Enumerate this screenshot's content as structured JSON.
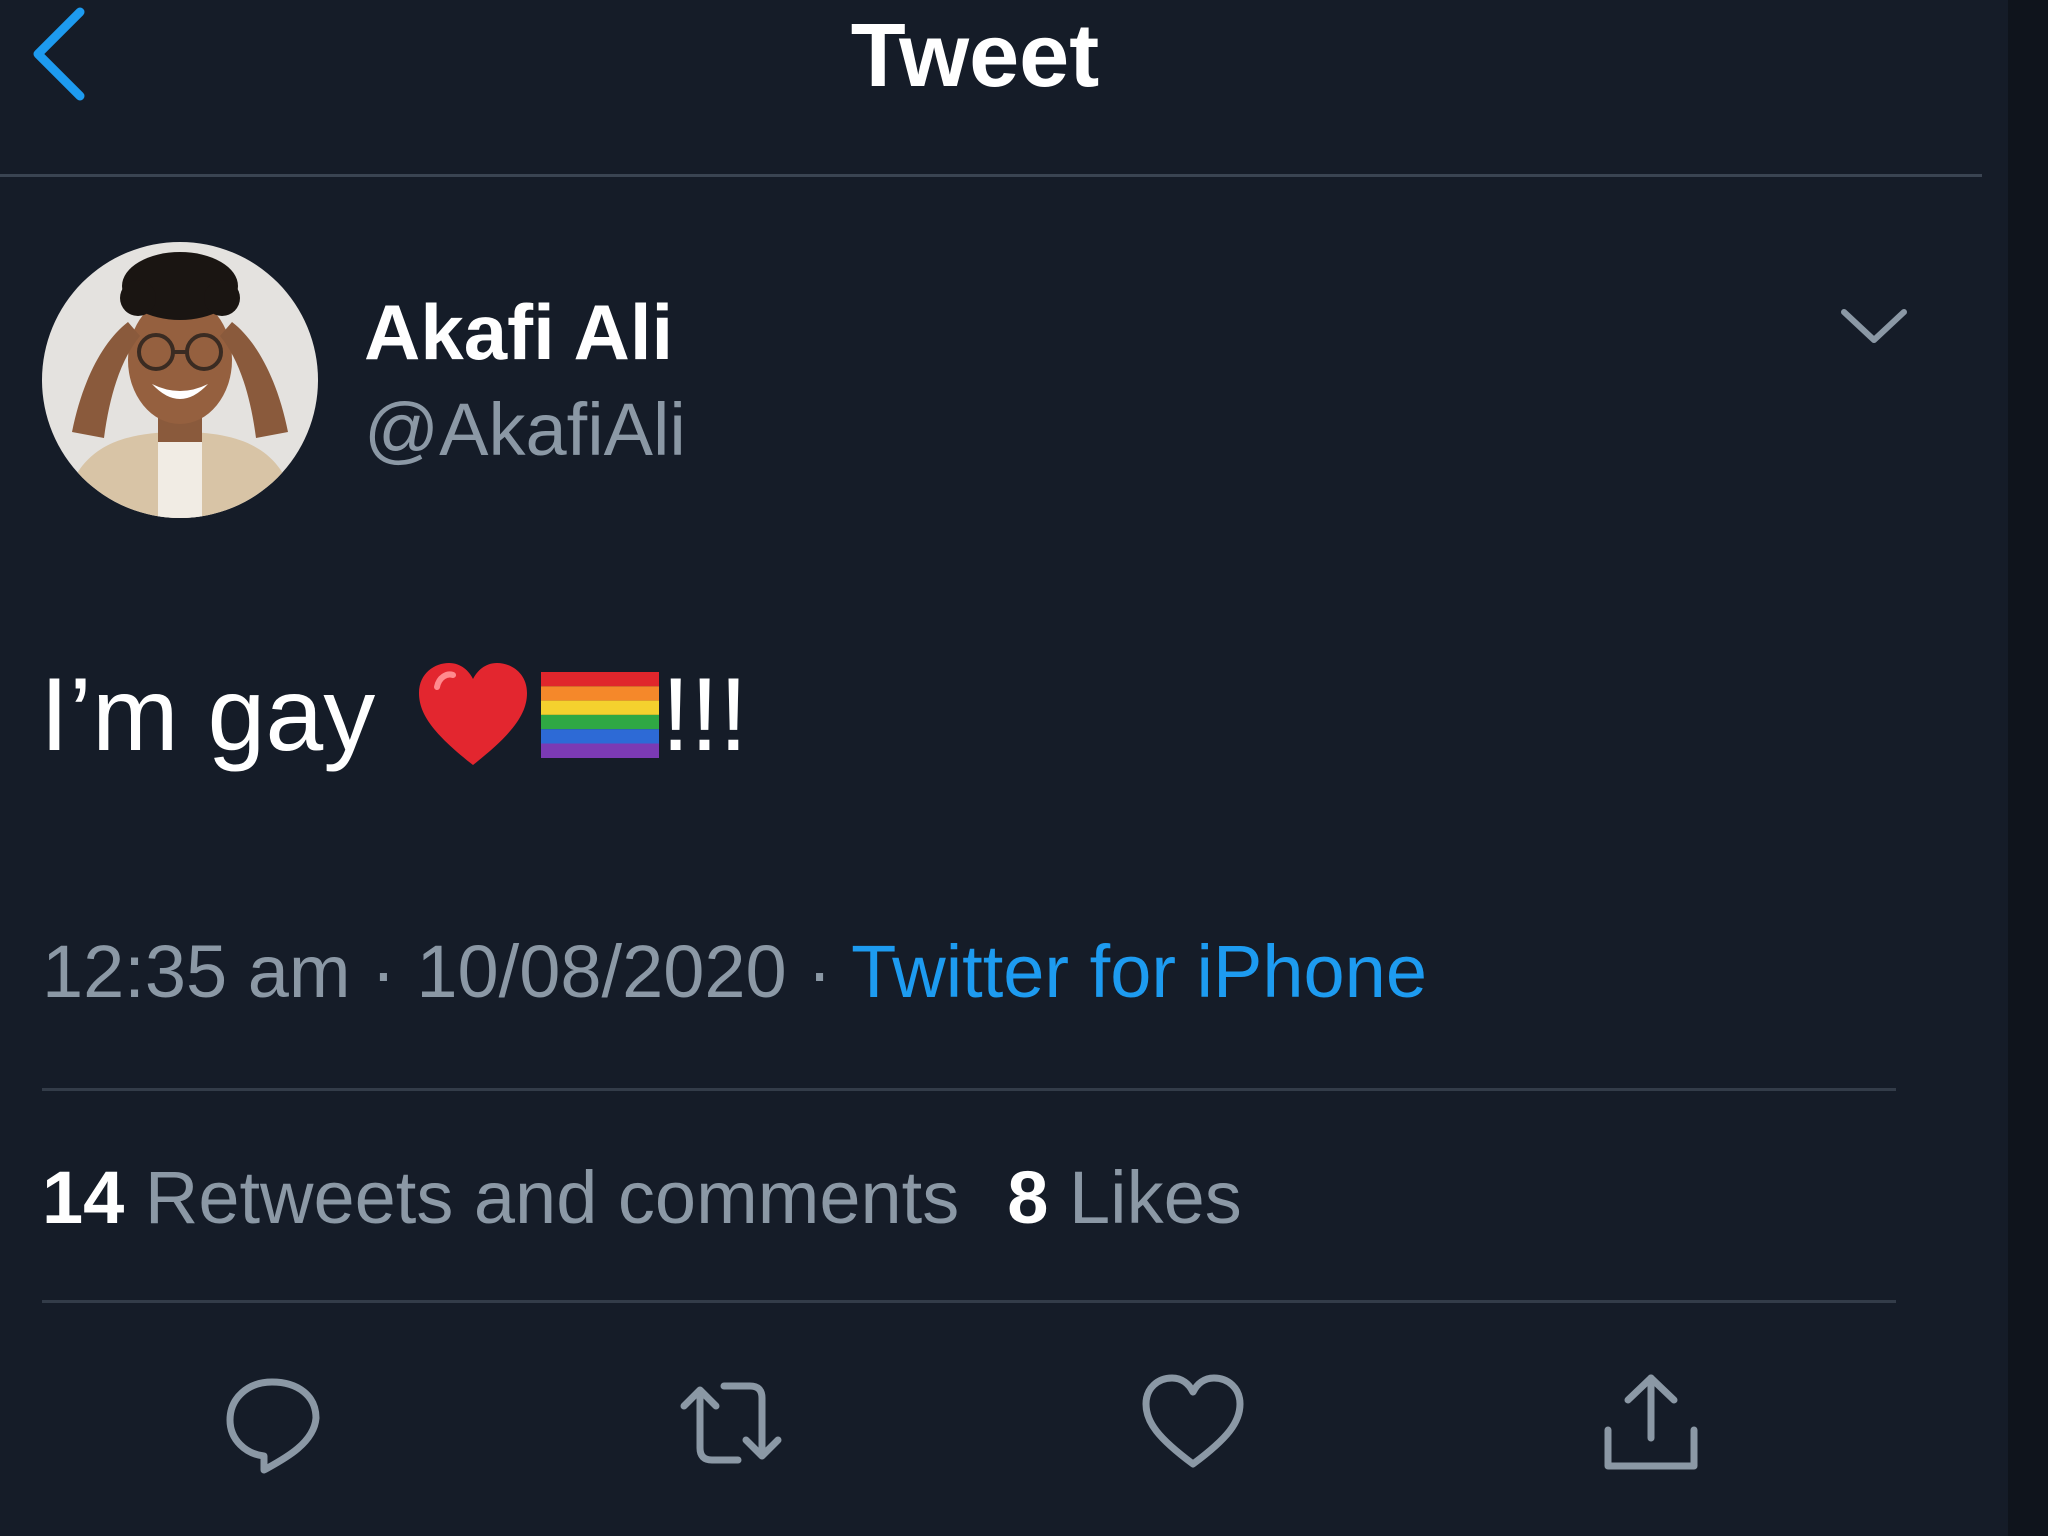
{
  "header": {
    "title": "Tweet",
    "back_icon": "chevron-left-icon"
  },
  "tweet": {
    "author": {
      "display_name": "Akafi Ali",
      "handle": "@AkafiAli"
    },
    "text_before": "I’m gay",
    "emojis": [
      "red-heart-icon",
      "rainbow-flag-icon"
    ],
    "text_after": "!!!",
    "time": "12:35 am",
    "date": "10/08/2020",
    "separator": "·",
    "source": "Twitter for iPhone"
  },
  "stats": {
    "retweets_count": "14",
    "retweets_label": "Retweets and comments",
    "likes_count": "8",
    "likes_label": "Likes"
  },
  "actions": [
    "reply-icon",
    "retweet-icon",
    "like-icon",
    "share-icon"
  ],
  "colors": {
    "background": "#151c28",
    "accent": "#1d9bf0",
    "secondary_text": "#8b98a5",
    "divider": "#333c49"
  }
}
